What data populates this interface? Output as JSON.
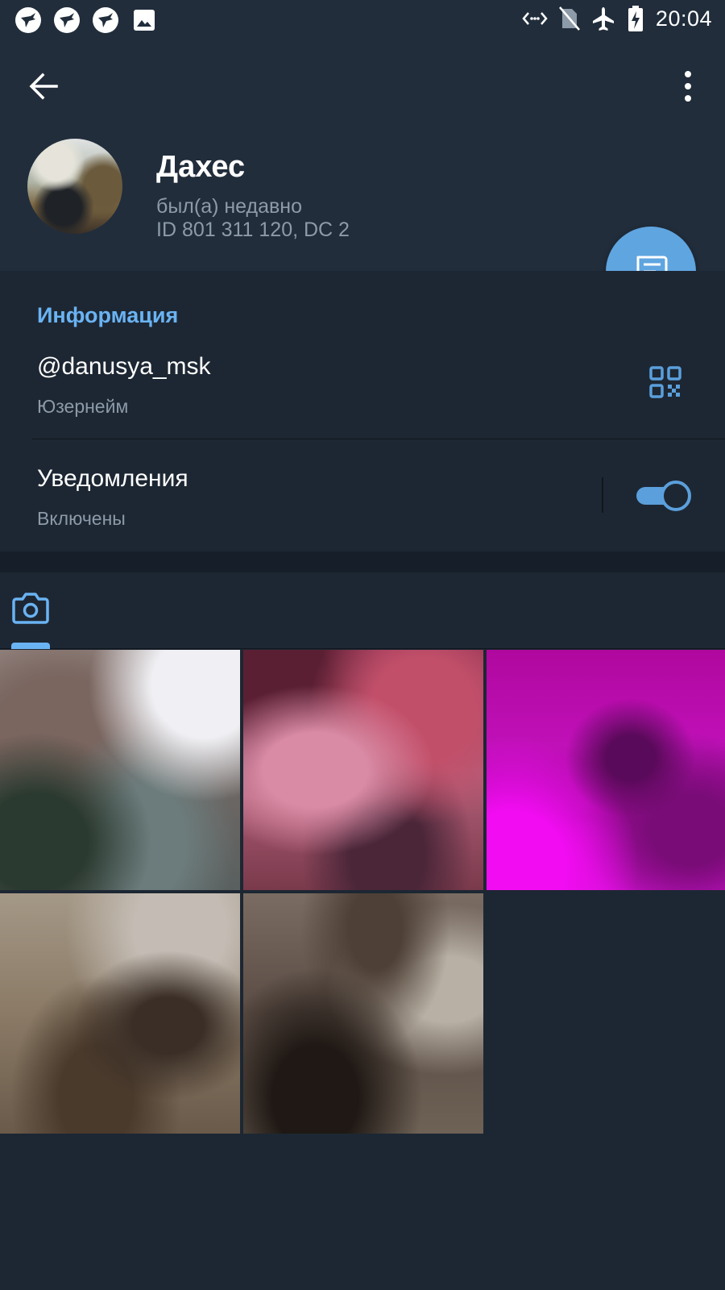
{
  "statusbar": {
    "time": "20:04",
    "left_icons": [
      "bird-app-icon",
      "bird-app-icon",
      "bird-app-icon",
      "image-icon"
    ],
    "right_icons": [
      "data-sync-icon",
      "no-sim-icon",
      "airplane-icon",
      "battery-charging-icon"
    ]
  },
  "header": {
    "back_icon": "arrow-left-icon",
    "more_icon": "more-vertical-icon",
    "name": "Дахес",
    "status": "был(а) недавно",
    "id_line": "ID 801 311 120, DC 2",
    "fab_icon": "message-icon"
  },
  "info": {
    "section_title": "Информация",
    "username": "@danusya_msk",
    "username_label": "Юзернейм",
    "qr_icon": "qr-code-icon",
    "notifications_title": "Уведомления",
    "notifications_status": "Включены",
    "notifications_enabled": true
  },
  "media": {
    "tabs": [
      {
        "icon": "camera-icon",
        "active": true
      }
    ],
    "photo_count": 5
  },
  "colors": {
    "accent": "#6ab3f3",
    "fab": "#5fa5e0",
    "header_bg": "#212d3b",
    "body_bg": "#1d2733",
    "secondary_text": "#8d9aa8"
  }
}
